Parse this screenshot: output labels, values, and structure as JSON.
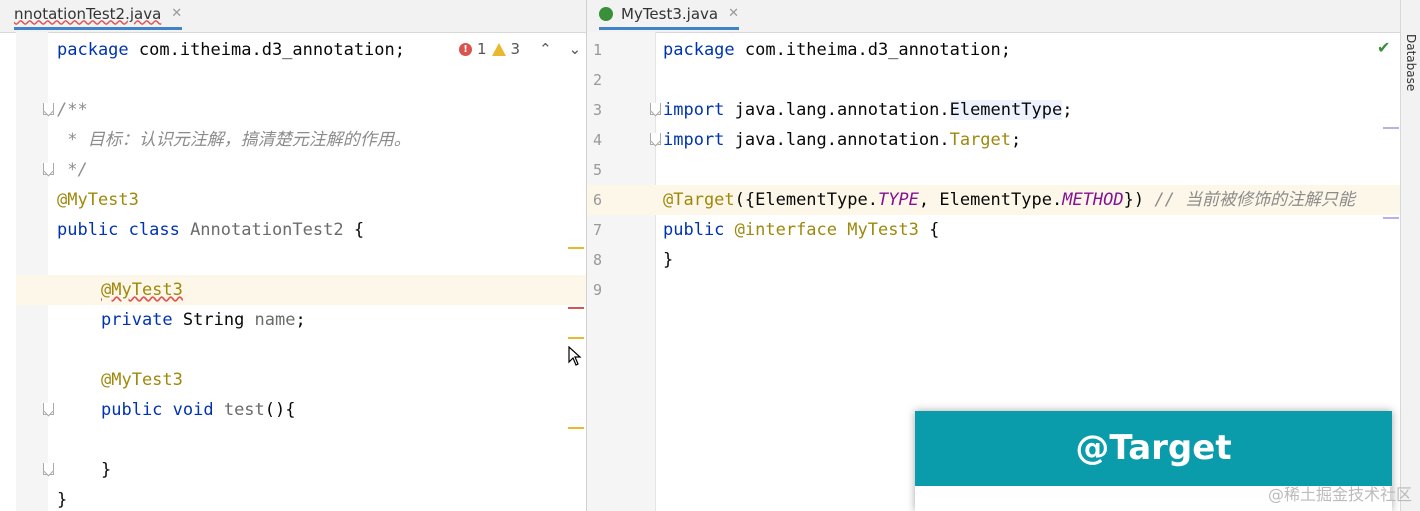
{
  "left_editor": {
    "tab": {
      "title": "nnotationTest2.java",
      "close": "✕"
    },
    "inspections": {
      "errors": "1",
      "warnings": "3"
    },
    "lines": {
      "l1": {
        "kw": "package",
        "rest": " com.itheima.d3_annotation;"
      },
      "l3": "/**",
      "l4": " * 目标：认识元注解，搞清楚元注解的作用。",
      "l5": " */",
      "l6": "@MyTest3",
      "l7": {
        "kw": "public class",
        "name": " AnnotationTest2",
        "rest": " {"
      },
      "l9": "@MyTest3",
      "l10": {
        "kw": "private",
        "type": " String",
        "name": " name",
        "rest": ";"
      },
      "l12": "@MyTest3",
      "l13": {
        "kw": "public void",
        "name": " test",
        "rest": "(){"
      },
      "l15": "}",
      "l16": "}"
    }
  },
  "right_editor": {
    "tab": {
      "title": "MyTest3.java",
      "close": "✕"
    },
    "line_numbers": [
      "1",
      "2",
      "3",
      "4",
      "5",
      "6",
      "7",
      "8",
      "9"
    ],
    "lines": {
      "l1": {
        "kw": "package",
        "rest": " com.itheima.d3_annotation;"
      },
      "l3": {
        "kw": "import",
        "pkg": " java.lang.annotation.",
        "cls": "ElementType",
        "rest": ";"
      },
      "l4": {
        "kw": "import",
        "pkg": " java.lang.annotation.",
        "cls": "Target",
        "rest": ";"
      },
      "l6": {
        "ann": "@Target",
        "p1": "({ElementType.",
        "f1": "TYPE",
        "p2": ", ElementType.",
        "f2": "METHOD",
        "p3": "}) ",
        "cmt": "// 当前被修饰的注解只能"
      },
      "l7": {
        "kw": "public",
        "ann": " @interface",
        "name": " MyTest3",
        "rest": " {"
      },
      "l8": "}"
    }
  },
  "sidebar": {
    "database_label": "Database"
  },
  "popup": {
    "title": "@Target"
  },
  "watermark": "@稀土掘金技术社区",
  "icons": [
    "error-icon",
    "warning-icon",
    "chevron-up-icon",
    "chevron-down-icon",
    "check-icon",
    "mouse-cursor-icon",
    "java-class-icon"
  ]
}
